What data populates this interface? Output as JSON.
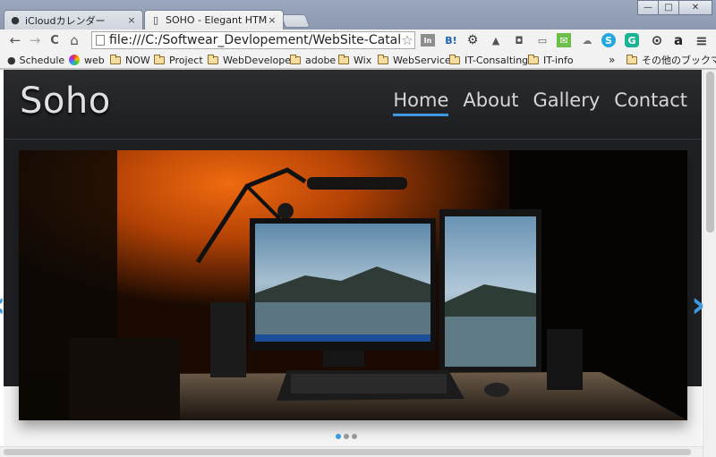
{
  "browser": {
    "tabs": [
      {
        "title": "iCloudカレンダー",
        "close": "×"
      },
      {
        "title": "SOHO - Elegant HTML",
        "close": "×"
      }
    ],
    "url": "file:///C:/Softwear_Devlopement/WebSite-Catalog/",
    "back": "←",
    "forward": "→",
    "reload": "C",
    "home": "⌂",
    "star": "☆",
    "extensions": [
      "In",
      "B!",
      "⚙",
      "▲",
      "◘",
      "▭",
      "✉",
      "☁",
      "S",
      "G",
      "⊙",
      "a",
      "≡"
    ],
    "window": {
      "minimize": "—",
      "maximize": "□",
      "close": "✕"
    }
  },
  "bookmarks": {
    "items": [
      "Schedule",
      "web",
      "NOW",
      "Project",
      "WebDeveloper",
      "adobe",
      "Wix",
      "WebService",
      "IT-Consalting",
      "IT-info"
    ],
    "overflow": "»",
    "other": "その他のブックマーク"
  },
  "site": {
    "logo": "Soho",
    "nav": [
      "Home",
      "About",
      "Gallery",
      "Contact"
    ],
    "active_nav": "Home",
    "slider": {
      "prev": "‹",
      "next": "›",
      "slide_count": 3,
      "active_index": 0
    },
    "accent": "#3b9ae1"
  }
}
